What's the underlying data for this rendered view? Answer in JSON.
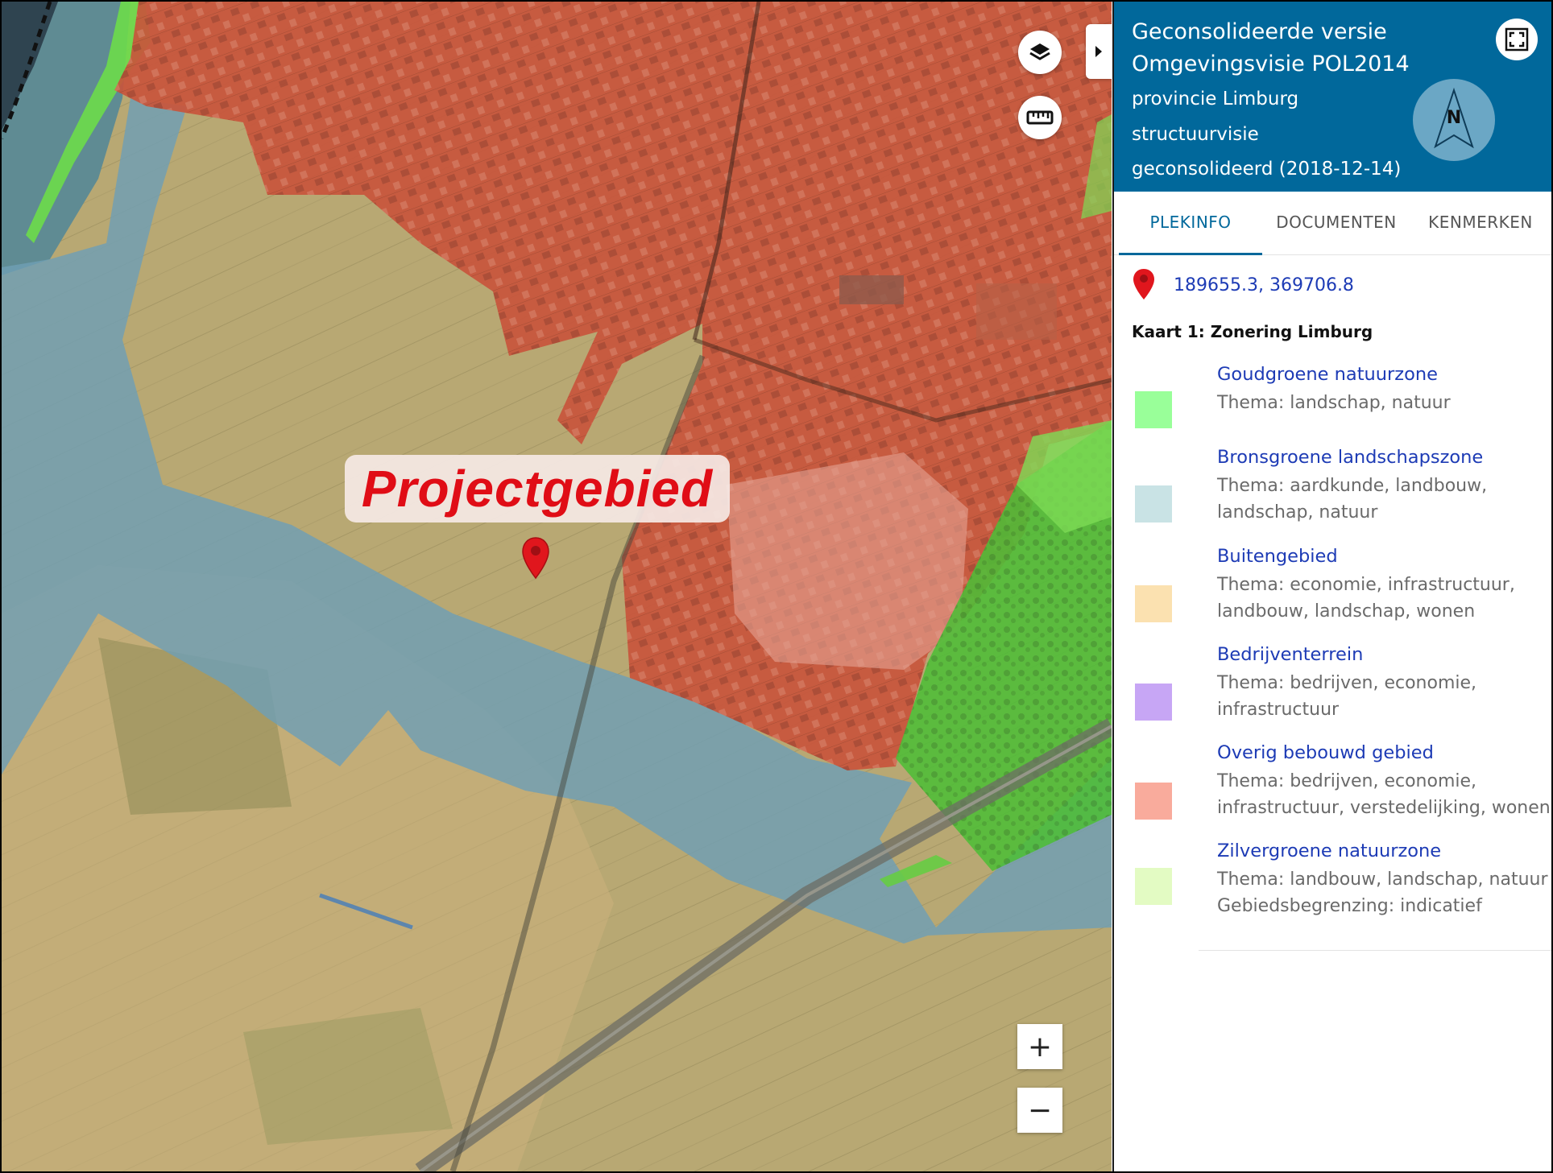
{
  "map": {
    "annotation_label": "Projectgebied",
    "icons": {
      "layers": "layers-icon",
      "measure": "ruler-icon",
      "collapse": "chevron-right-icon",
      "marker": "map-marker-icon"
    },
    "zoom_in_label": "+",
    "zoom_out_label": "−"
  },
  "sidebar": {
    "header": {
      "title": "Geconsolideerde versie Omgevingsvisie POL2014",
      "organisation": "provincie Limburg",
      "plan_type": "structuurvisie",
      "status": "geconsolideerd (2018-12-14)",
      "north_label": "N"
    },
    "tabs": [
      {
        "label": "PLEKINFO",
        "active": true
      },
      {
        "label": "DOCUMENTEN",
        "active": false
      },
      {
        "label": "KENMERKEN",
        "active": false
      }
    ],
    "coordinates": "189655.3, 369706.8",
    "map_title": "Kaart 1: Zonering Limburg",
    "legend": [
      {
        "name": "Goudgroene natuurzone",
        "lines": [
          "Thema: landschap, natuur"
        ],
        "color": "#99ff99"
      },
      {
        "name": "Bronsgroene landschapszone",
        "lines": [
          "Thema: aardkunde, landbouw,",
          "landschap, natuur"
        ],
        "color": "#c9e3e5"
      },
      {
        "name": "Buitengebied",
        "lines": [
          "Thema: economie, infrastructuur,",
          "landbouw, landschap, wonen"
        ],
        "color": "#fbe1b0"
      },
      {
        "name": "Bedrijventerrein",
        "lines": [
          "Thema: bedrijven, economie,",
          "infrastructuur"
        ],
        "color": "#c7a6f5"
      },
      {
        "name": "Overig bebouwd gebied",
        "lines": [
          "Thema: bedrijven, economie,",
          "infrastructuur, verstedelijking, wonen"
        ],
        "color": "#f9ab9c"
      },
      {
        "name": "Zilvergroene natuurzone",
        "lines": [
          "Thema: landbouw, landschap, natuur",
          "Gebiedsbegrenzing: indicatief"
        ],
        "color": "#e3fbc3"
      }
    ]
  }
}
